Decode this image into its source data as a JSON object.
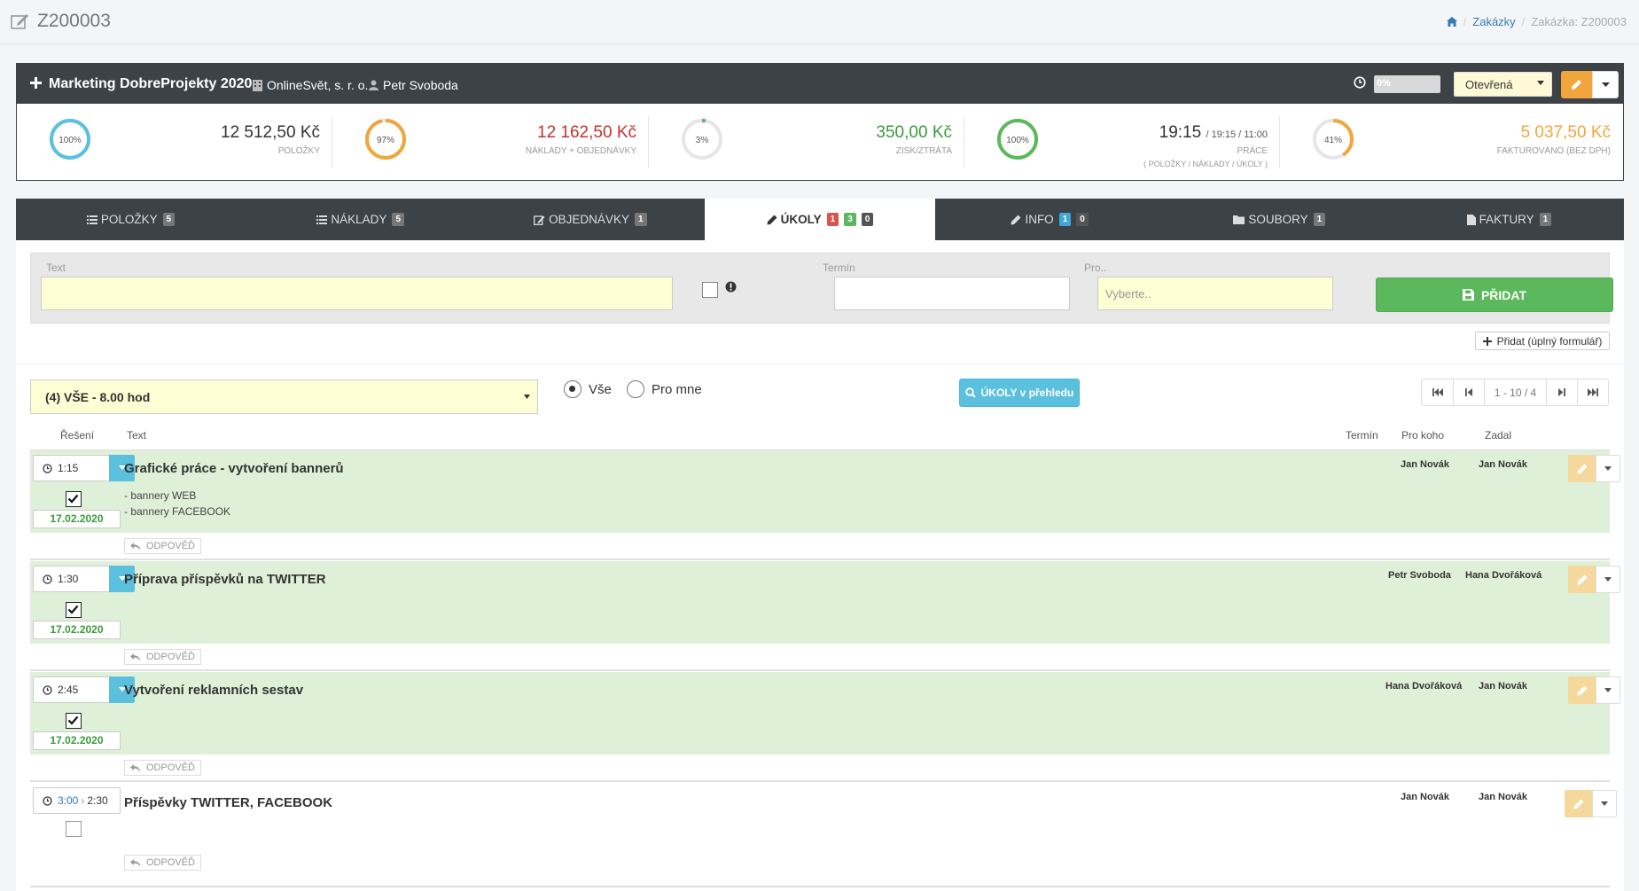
{
  "page": {
    "title": "Z200003"
  },
  "breadcrumb": {
    "home_icon": "home-icon",
    "items": [
      "Zakázky",
      "Zakázka: Z200003"
    ]
  },
  "order": {
    "title": "Marketing DobreProjekty 2020",
    "company": "OnlineSvět, s. r. o.",
    "user": "Petr Svoboda",
    "progress": 0,
    "progress_label": "0%",
    "status": "Otevřená"
  },
  "stats": [
    {
      "ring": 100,
      "ring_label": "100%",
      "ring_color": "#5bc0de",
      "value": "12 512,50 Kč",
      "value_color": "#333",
      "label": "POLOŽKY",
      "label2": ""
    },
    {
      "ring": 97,
      "ring_label": "97%",
      "ring_color": "#f0a63d",
      "value": "12 162,50 Kč",
      "value_color": "#c9302c",
      "label": "NÁKLADY + OBJEDNÁVKY",
      "label2": ""
    },
    {
      "ring": 3,
      "ring_label": "3%",
      "ring_color": "#5cb85c",
      "value": "350,00 Kč",
      "value_color": "#3a9a3a",
      "label": "ZISK/ZTRÁTA",
      "label2": ""
    },
    {
      "ring": 100,
      "ring_label": "100%",
      "ring_color": "#5cb85c",
      "value": "19:15",
      "value_small": "/ 19:15 / 11:00",
      "value_color": "#333",
      "label": "PRÁCE",
      "label2": "( POLOŽKY / NÁKLADY / ÚKOLY )"
    },
    {
      "ring": 41,
      "ring_label": "41%",
      "ring_color": "#f0a63d",
      "value": "5 037,50 Kč",
      "value_color": "#f0a63d",
      "label": "FAKTUROVÁNO (BEZ DPH)",
      "label2": ""
    }
  ],
  "tabs": [
    {
      "label": "POLOŽKY",
      "counts": [
        "5"
      ]
    },
    {
      "label": "NÁKLADY",
      "counts": [
        "5"
      ]
    },
    {
      "label": "OBJEDNÁVKY",
      "counts": [
        "1"
      ]
    },
    {
      "label": "ÚKOLY",
      "counts": [
        "1",
        "3",
        "0"
      ]
    },
    {
      "label": "INFO",
      "counts": [
        "1",
        "0"
      ]
    },
    {
      "label": "SOUBORY",
      "counts": [
        "1"
      ]
    },
    {
      "label": "FAKTURY",
      "counts": [
        "1"
      ]
    }
  ],
  "form": {
    "text_label": "Text",
    "term_label": "Termín",
    "for_label": "Pro..",
    "for_placeholder": "Vyberte..",
    "add_label": "PŘIDAT",
    "full_label": "Přidat (úplný formulář)"
  },
  "filter": {
    "value": "(4) VŠE - 8.00 hod",
    "radio_all": "Vše",
    "radio_me": "Pro mne",
    "overview_label": "ÚKOLY v přehledu",
    "pager": "1 - 10 / 4"
  },
  "columns": {
    "solution": "Řešení",
    "text": "Text",
    "term": "Termín",
    "for": "Pro koho",
    "by": "Zadal"
  },
  "tasks": [
    {
      "time": "1:15",
      "date": "17.02.2020",
      "title": "Grafické práce - vytvoření bannerů",
      "desc1": "- bannery WEB",
      "desc2": "- bannery FACEBOOK",
      "for": "Jan Novák",
      "by": "Jan Novák",
      "reply": "ODPOVĚĎ",
      "done": true
    },
    {
      "time": "1:30",
      "date": "17.02.2020",
      "title": "Příprava příspěvků na TWITTER",
      "desc1": "",
      "desc2": "",
      "for": "Petr Svoboda",
      "by": "Hana Dvořáková",
      "reply": "ODPOVĚĎ",
      "done": true
    },
    {
      "time": "2:45",
      "date": "17.02.2020",
      "title": "Vytvoření reklamních sestav",
      "desc1": "",
      "desc2": "",
      "for": "Hana Dvořáková",
      "by": "Jan Novák",
      "reply": "ODPOVĚĎ",
      "done": true
    },
    {
      "time_plan": "3:00",
      "time_sep": "›",
      "time": "2:30",
      "title": "Příspěvky TWITTER, FACEBOOK",
      "for": "Jan Novák",
      "by": "Jan Novák",
      "reply": "ODPOVĚĎ",
      "done": false
    }
  ]
}
